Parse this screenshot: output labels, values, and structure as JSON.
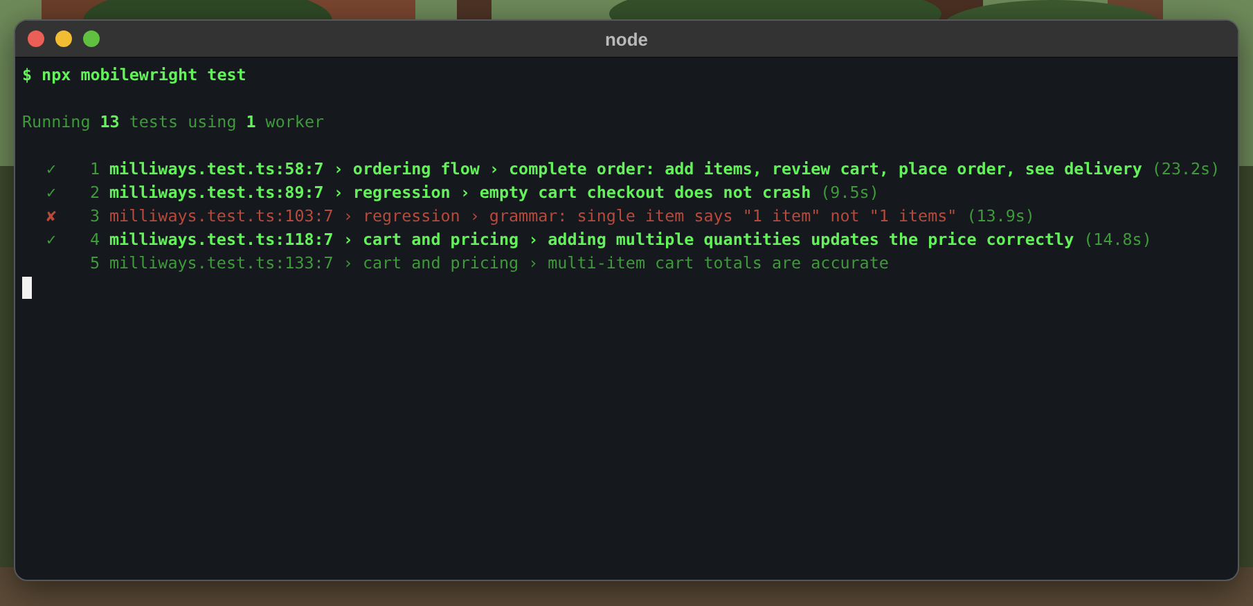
{
  "window": {
    "title": "node"
  },
  "command": {
    "prompt": "$",
    "text": "npx mobilewright test"
  },
  "summary": {
    "prefix": "Running",
    "tests": "13",
    "middle": "tests using",
    "workers": "1",
    "suffix": "worker"
  },
  "tests": [
    {
      "kind": "passed",
      "mark": "✓",
      "number": "1",
      "title": "milliways.test.ts:58:7 › ordering flow › complete order: add items, review cart, place order, see delivery",
      "duration": "(23.2s)"
    },
    {
      "kind": "passed",
      "mark": "✓",
      "number": "2",
      "title": "milliways.test.ts:89:7 › regression › empty cart checkout does not crash",
      "duration": "(9.5s)"
    },
    {
      "kind": "failed",
      "mark": "✘",
      "number": "3",
      "title": "milliways.test.ts:103:7 › regression › grammar: single item says \"1 item\" not \"1 items\"",
      "duration": "(13.9s)"
    },
    {
      "kind": "passed",
      "mark": "✓",
      "number": "4",
      "title": "milliways.test.ts:118:7 › cart and pricing › adding multiple quantities updates the price correctly",
      "duration": "(14.8s)"
    },
    {
      "kind": "running",
      "number": "5",
      "title": "milliways.test.ts:133:7 › cart and pricing › multi-item cart totals are accurate"
    }
  ]
}
